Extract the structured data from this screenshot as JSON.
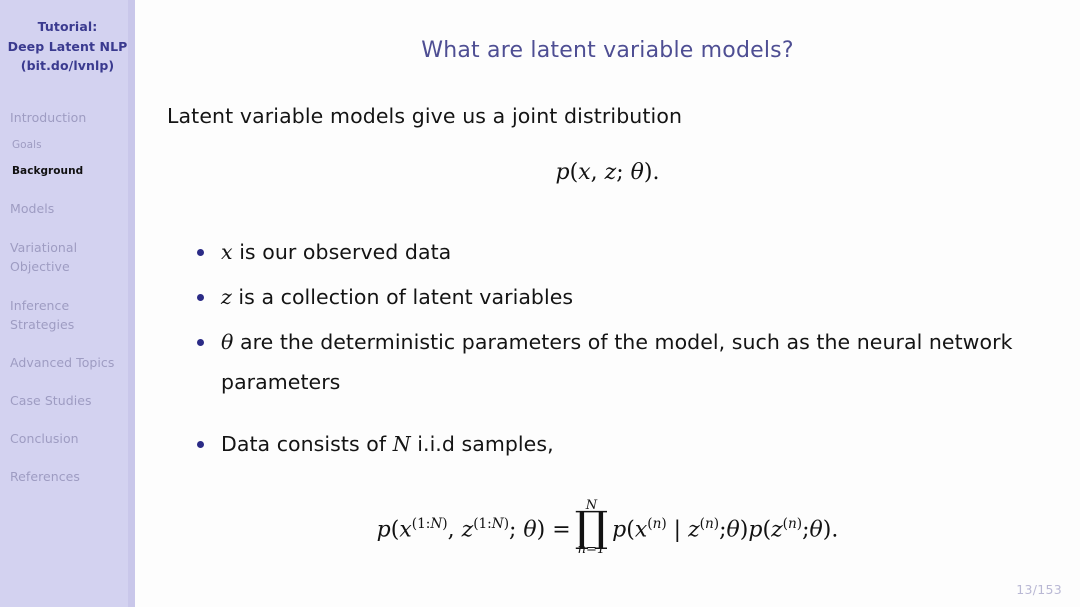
{
  "slide": {
    "page_indicator": "13/153",
    "background_color": "#fdfdfd"
  },
  "sidebar": {
    "background_color": "#d3d2f0",
    "title_color": "#3a3a8f",
    "inactive_color": "#9e9cc2",
    "active_color": "#111111",
    "title_lines": [
      "Tutorial:",
      "Deep Latent NLP",
      "(bit.do/lvnlp)"
    ],
    "items": [
      {
        "label": "Introduction",
        "level": "section",
        "active": false
      },
      {
        "label": "Goals",
        "level": "subsection",
        "active": false
      },
      {
        "label": "Background",
        "level": "subsection",
        "active": true
      },
      {
        "label": "Models",
        "level": "section",
        "active": false
      },
      {
        "label": "Variational",
        "label2": "Objective",
        "level": "section",
        "active": false
      },
      {
        "label": "Inference",
        "label2": "Strategies",
        "level": "section",
        "active": false
      },
      {
        "label": "Advanced Topics",
        "level": "section",
        "active": false
      },
      {
        "label": "Case Studies",
        "level": "section",
        "active": false
      },
      {
        "label": "Conclusion",
        "level": "section",
        "active": false
      },
      {
        "label": "References",
        "level": "section",
        "active": false
      }
    ]
  },
  "main": {
    "title": "What are latent variable models?",
    "title_color": "#4e4e93",
    "lead_text": "Latent variable models give us a joint distribution",
    "equation_joint": "p(x, z; θ).",
    "bullet_color": "#2b2b86",
    "bullets": [
      {
        "math_lead": "x",
        "text": " is our observed data"
      },
      {
        "math_lead": "z",
        "text": " is a collection of latent variables"
      },
      {
        "math_lead": "θ",
        "text": " are the deterministic parameters of the model, such as the neural network parameters"
      },
      {
        "math_lead": "",
        "text_pre": "Data consists of ",
        "math_mid": "N",
        "text_post": " i.i.d samples,"
      }
    ],
    "equation_factorized": {
      "lhs": "p(x(1:N), z(1:N); θ) =",
      "product_upper": "N",
      "product_symbol": "∏",
      "product_lower": "n=1",
      "rhs": "p(x(n) | z(n); θ)p(z(n); θ)."
    }
  }
}
